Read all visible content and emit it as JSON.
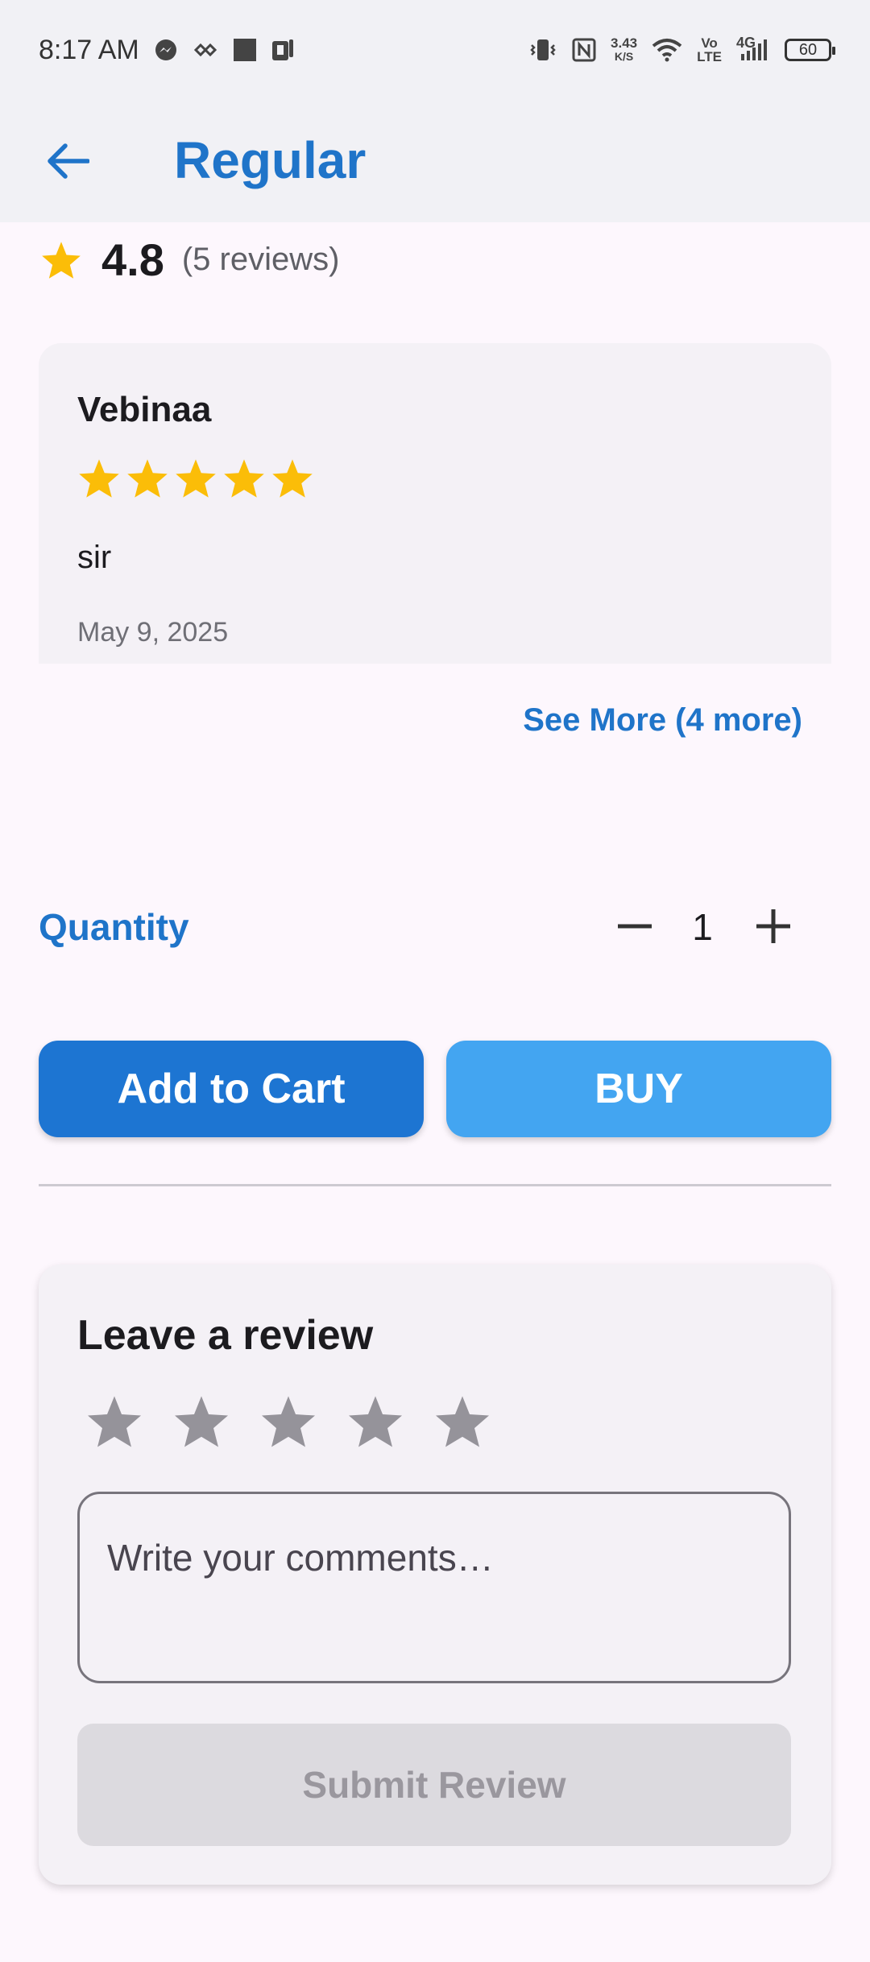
{
  "status_bar": {
    "time": "8:17 AM",
    "net_speed_value": "3.43",
    "net_speed_unit": "K/S",
    "volte_top": "Vo",
    "volte_bottom": "LTE",
    "network": "4G",
    "battery": "60",
    "icons": [
      "messenger-icon",
      "link-icon",
      "square-icon",
      "pocket-icon",
      "vibrate-icon",
      "nfc-icon",
      "wifi-icon",
      "signal-icon",
      "battery-icon"
    ]
  },
  "app_bar": {
    "title": "Regular",
    "back_icon": "arrow-left-icon"
  },
  "rating_summary": {
    "average": "4.8",
    "count_text": "(5 reviews)"
  },
  "review": {
    "author": "Vebinaa",
    "rating": 5,
    "comment": "sir",
    "date": "May 9, 2025"
  },
  "see_more_label": "See More (4 more)",
  "quantity": {
    "label": "Quantity",
    "value": "1"
  },
  "buttons": {
    "add_to_cart": "Add to Cart",
    "buy": "BUY"
  },
  "leave_review": {
    "title": "Leave a review",
    "placeholder": "Write your comments…",
    "submit_label": "Submit Review",
    "selected_rating": 0
  },
  "colors": {
    "primary": "#1f74c9",
    "buy": "#43a5f1",
    "star_filled": "#fbbd08",
    "star_empty": "#95939a"
  }
}
